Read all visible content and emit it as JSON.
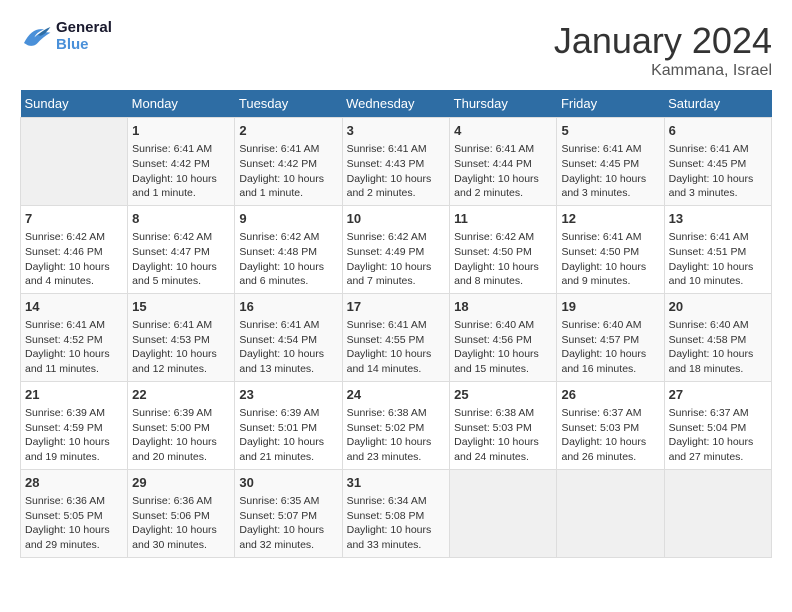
{
  "logo": {
    "text_general": "General",
    "text_blue": "Blue"
  },
  "title": "January 2024",
  "location": "Kammana, Israel",
  "days_header": [
    "Sunday",
    "Monday",
    "Tuesday",
    "Wednesday",
    "Thursday",
    "Friday",
    "Saturday"
  ],
  "weeks": [
    [
      {
        "day": "",
        "sunrise": "",
        "sunset": "",
        "daylight": ""
      },
      {
        "day": "1",
        "sunrise": "Sunrise: 6:41 AM",
        "sunset": "Sunset: 4:42 PM",
        "daylight": "Daylight: 10 hours and 1 minute."
      },
      {
        "day": "2",
        "sunrise": "Sunrise: 6:41 AM",
        "sunset": "Sunset: 4:42 PM",
        "daylight": "Daylight: 10 hours and 1 minute."
      },
      {
        "day": "3",
        "sunrise": "Sunrise: 6:41 AM",
        "sunset": "Sunset: 4:43 PM",
        "daylight": "Daylight: 10 hours and 2 minutes."
      },
      {
        "day": "4",
        "sunrise": "Sunrise: 6:41 AM",
        "sunset": "Sunset: 4:44 PM",
        "daylight": "Daylight: 10 hours and 2 minutes."
      },
      {
        "day": "5",
        "sunrise": "Sunrise: 6:41 AM",
        "sunset": "Sunset: 4:45 PM",
        "daylight": "Daylight: 10 hours and 3 minutes."
      },
      {
        "day": "6",
        "sunrise": "Sunrise: 6:41 AM",
        "sunset": "Sunset: 4:45 PM",
        "daylight": "Daylight: 10 hours and 3 minutes."
      }
    ],
    [
      {
        "day": "7",
        "sunrise": "Sunrise: 6:42 AM",
        "sunset": "Sunset: 4:46 PM",
        "daylight": "Daylight: 10 hours and 4 minutes."
      },
      {
        "day": "8",
        "sunrise": "Sunrise: 6:42 AM",
        "sunset": "Sunset: 4:47 PM",
        "daylight": "Daylight: 10 hours and 5 minutes."
      },
      {
        "day": "9",
        "sunrise": "Sunrise: 6:42 AM",
        "sunset": "Sunset: 4:48 PM",
        "daylight": "Daylight: 10 hours and 6 minutes."
      },
      {
        "day": "10",
        "sunrise": "Sunrise: 6:42 AM",
        "sunset": "Sunset: 4:49 PM",
        "daylight": "Daylight: 10 hours and 7 minutes."
      },
      {
        "day": "11",
        "sunrise": "Sunrise: 6:42 AM",
        "sunset": "Sunset: 4:50 PM",
        "daylight": "Daylight: 10 hours and 8 minutes."
      },
      {
        "day": "12",
        "sunrise": "Sunrise: 6:41 AM",
        "sunset": "Sunset: 4:50 PM",
        "daylight": "Daylight: 10 hours and 9 minutes."
      },
      {
        "day": "13",
        "sunrise": "Sunrise: 6:41 AM",
        "sunset": "Sunset: 4:51 PM",
        "daylight": "Daylight: 10 hours and 10 minutes."
      }
    ],
    [
      {
        "day": "14",
        "sunrise": "Sunrise: 6:41 AM",
        "sunset": "Sunset: 4:52 PM",
        "daylight": "Daylight: 10 hours and 11 minutes."
      },
      {
        "day": "15",
        "sunrise": "Sunrise: 6:41 AM",
        "sunset": "Sunset: 4:53 PM",
        "daylight": "Daylight: 10 hours and 12 minutes."
      },
      {
        "day": "16",
        "sunrise": "Sunrise: 6:41 AM",
        "sunset": "Sunset: 4:54 PM",
        "daylight": "Daylight: 10 hours and 13 minutes."
      },
      {
        "day": "17",
        "sunrise": "Sunrise: 6:41 AM",
        "sunset": "Sunset: 4:55 PM",
        "daylight": "Daylight: 10 hours and 14 minutes."
      },
      {
        "day": "18",
        "sunrise": "Sunrise: 6:40 AM",
        "sunset": "Sunset: 4:56 PM",
        "daylight": "Daylight: 10 hours and 15 minutes."
      },
      {
        "day": "19",
        "sunrise": "Sunrise: 6:40 AM",
        "sunset": "Sunset: 4:57 PM",
        "daylight": "Daylight: 10 hours and 16 minutes."
      },
      {
        "day": "20",
        "sunrise": "Sunrise: 6:40 AM",
        "sunset": "Sunset: 4:58 PM",
        "daylight": "Daylight: 10 hours and 18 minutes."
      }
    ],
    [
      {
        "day": "21",
        "sunrise": "Sunrise: 6:39 AM",
        "sunset": "Sunset: 4:59 PM",
        "daylight": "Daylight: 10 hours and 19 minutes."
      },
      {
        "day": "22",
        "sunrise": "Sunrise: 6:39 AM",
        "sunset": "Sunset: 5:00 PM",
        "daylight": "Daylight: 10 hours and 20 minutes."
      },
      {
        "day": "23",
        "sunrise": "Sunrise: 6:39 AM",
        "sunset": "Sunset: 5:01 PM",
        "daylight": "Daylight: 10 hours and 21 minutes."
      },
      {
        "day": "24",
        "sunrise": "Sunrise: 6:38 AM",
        "sunset": "Sunset: 5:02 PM",
        "daylight": "Daylight: 10 hours and 23 minutes."
      },
      {
        "day": "25",
        "sunrise": "Sunrise: 6:38 AM",
        "sunset": "Sunset: 5:03 PM",
        "daylight": "Daylight: 10 hours and 24 minutes."
      },
      {
        "day": "26",
        "sunrise": "Sunrise: 6:37 AM",
        "sunset": "Sunset: 5:03 PM",
        "daylight": "Daylight: 10 hours and 26 minutes."
      },
      {
        "day": "27",
        "sunrise": "Sunrise: 6:37 AM",
        "sunset": "Sunset: 5:04 PM",
        "daylight": "Daylight: 10 hours and 27 minutes."
      }
    ],
    [
      {
        "day": "28",
        "sunrise": "Sunrise: 6:36 AM",
        "sunset": "Sunset: 5:05 PM",
        "daylight": "Daylight: 10 hours and 29 minutes."
      },
      {
        "day": "29",
        "sunrise": "Sunrise: 6:36 AM",
        "sunset": "Sunset: 5:06 PM",
        "daylight": "Daylight: 10 hours and 30 minutes."
      },
      {
        "day": "30",
        "sunrise": "Sunrise: 6:35 AM",
        "sunset": "Sunset: 5:07 PM",
        "daylight": "Daylight: 10 hours and 32 minutes."
      },
      {
        "day": "31",
        "sunrise": "Sunrise: 6:34 AM",
        "sunset": "Sunset: 5:08 PM",
        "daylight": "Daylight: 10 hours and 33 minutes."
      },
      {
        "day": "",
        "sunrise": "",
        "sunset": "",
        "daylight": ""
      },
      {
        "day": "",
        "sunrise": "",
        "sunset": "",
        "daylight": ""
      },
      {
        "day": "",
        "sunrise": "",
        "sunset": "",
        "daylight": ""
      }
    ]
  ]
}
